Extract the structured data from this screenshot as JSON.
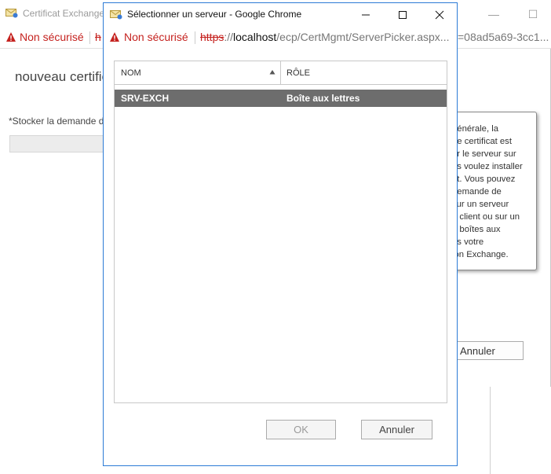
{
  "background_window": {
    "title": "Certificat Exchange",
    "security_label": "Non sécurisé",
    "url_head": "h",
    "url_tail": "=08ad5a69-3cc1...",
    "heading": "nouveau certific",
    "field_label": "*Stocker la demande d",
    "tooltip_lines": [
      "générale, la",
      "de certificat est",
      "ur le serveur sur",
      "us voulez installer",
      "at. Vous pouvez",
      "demande de",
      "sur un serveur",
      "u client ou sur un",
      "e boîtes aux",
      "ns votre",
      "ion Exchange."
    ],
    "cancel_label": "Annuler"
  },
  "dialog": {
    "title": "Sélectionner un serveur - Google Chrome",
    "security_label": "Non sécurisé",
    "url": {
      "scheme": "https",
      "separator": "://",
      "host": "localhost",
      "path": "/ecp/CertMgmt/ServerPicker.aspx..."
    },
    "grid": {
      "columns": [
        "NOM",
        "RÔLE"
      ],
      "sort": "NOM ascending",
      "rows": [
        {
          "name": "SRV-EXCH",
          "role": "Boîte aux lettres",
          "selected": true
        }
      ]
    },
    "ok_label": "OK",
    "cancel_label": "Annuler"
  },
  "colors": {
    "dialog_border": "#2c7bd6",
    "warning_red": "#c5221f",
    "selected_row": "#6d6d6d"
  },
  "icons": [
    "exchange-envelope-icon",
    "warning-triangle-icon",
    "minimize-icon",
    "maximize-icon",
    "close-icon",
    "sort-ascending-icon"
  ]
}
